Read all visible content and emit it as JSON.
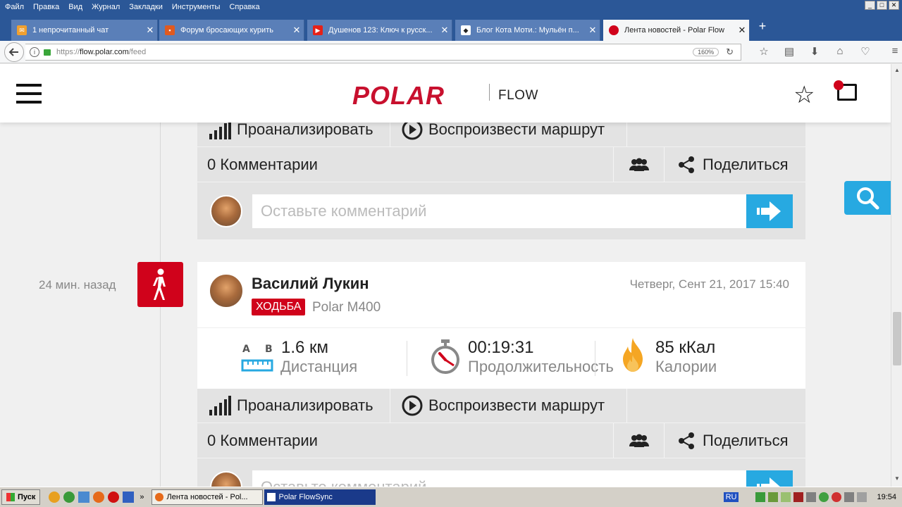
{
  "browser": {
    "menu": [
      "Файл",
      "Правка",
      "Вид",
      "Журнал",
      "Закладки",
      "Инструменты",
      "Справка"
    ],
    "tabs": [
      {
        "title": "1 непрочитанный чат",
        "icon": "mail-icon",
        "color": "#f0a030"
      },
      {
        "title": "Форум бросающих курить",
        "icon": "forum-icon",
        "color": "#e05a20"
      },
      {
        "title": "Душенов 123: Ключ к русск...",
        "icon": "youtube-icon",
        "color": "#e62117"
      },
      {
        "title": "Блог Кота Моти.: Мульён п...",
        "icon": "cat-icon",
        "color": "#222222"
      },
      {
        "title": "Лента новостей - Polar Flow",
        "icon": "polar-icon",
        "color": "#d0021b",
        "active": true
      }
    ],
    "url_prefix": "https://",
    "url_host": "flow.polar.com",
    "url_path": "/feed",
    "zoom": "160%"
  },
  "header": {
    "logo": "POLAR",
    "product": "FLOW"
  },
  "prev_card": {
    "analyze_label": "Проанализировать",
    "replay_label": "Воспроизвести маршрут",
    "comments_label": "0 Комментарии",
    "share_label": "Поделиться",
    "comment_placeholder": "Оставьте комментарий"
  },
  "activity": {
    "time_ago": "24 мин. назад",
    "user_name": "Василий Лукин",
    "sport_tag": "ХОДЬБА",
    "device": "Polar M400",
    "date": "Четверг, Сент 21, 2017 15:40",
    "distance_value": "1.6 км",
    "distance_label": "Дистанция",
    "distance_a": "A",
    "distance_b": "B",
    "duration_value": "00:19:31",
    "duration_label": "Продолжительность",
    "calories_value": "85 кКал",
    "calories_label": "Калории",
    "analyze_label": "Проанализировать",
    "replay_label": "Воспроизвести маршрут",
    "comments_label": "0 Комментарии",
    "share_label": "Поделиться",
    "comment_placeholder": "Оставьте комментарий"
  },
  "taskbar": {
    "start_label": "Пуск",
    "tasks": [
      "Лента новостей - Pol...",
      "Polar FlowSync"
    ],
    "lang": "RU",
    "clock": "19:54"
  },
  "colors": {
    "polar_red": "#d0021b",
    "accent_blue": "#27a9e1",
    "card_gray": "#e3e3e3"
  }
}
